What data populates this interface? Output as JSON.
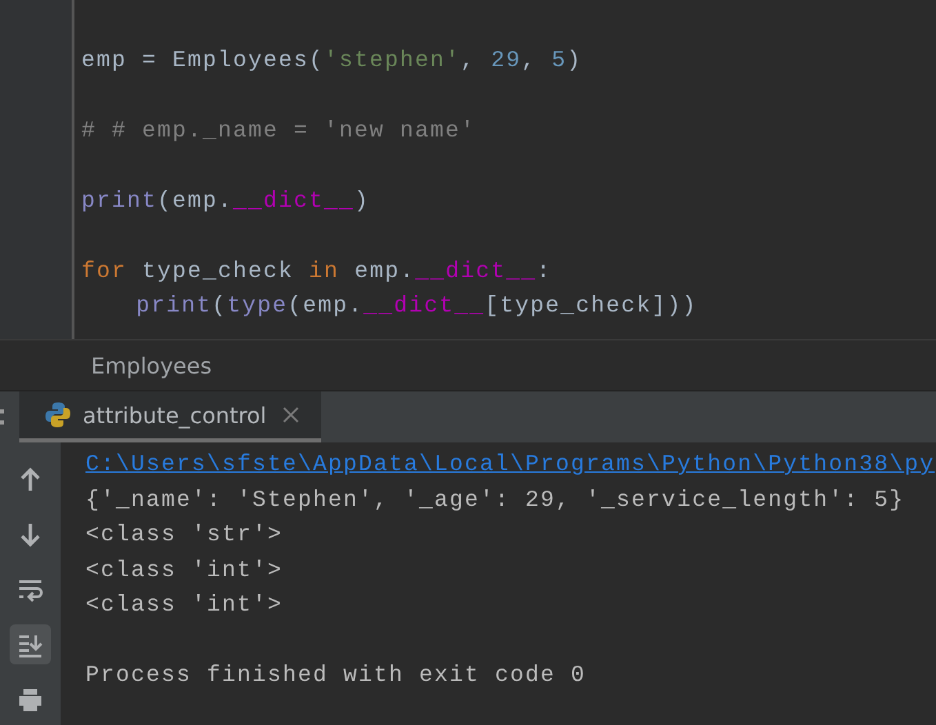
{
  "editor": {
    "lines": [
      {
        "kind": "blank"
      },
      {
        "kind": "code",
        "tokens": [
          {
            "kind": "plain",
            "text": "emp = Employees("
          },
          {
            "kind": "string",
            "text": "'stephen'"
          },
          {
            "kind": "plain",
            "text": ", "
          },
          {
            "kind": "number",
            "text": "29"
          },
          {
            "kind": "plain",
            "text": ", "
          },
          {
            "kind": "number",
            "text": "5"
          },
          {
            "kind": "plain",
            "text": ")"
          }
        ]
      },
      {
        "kind": "blank"
      },
      {
        "kind": "code",
        "tokens": [
          {
            "kind": "comment",
            "text": "# # emp._name = 'new name'"
          }
        ]
      },
      {
        "kind": "blank"
      },
      {
        "kind": "code",
        "tokens": [
          {
            "kind": "builtin",
            "text": "print"
          },
          {
            "kind": "plain",
            "text": "(emp."
          },
          {
            "kind": "dunder",
            "text": "__dict__"
          },
          {
            "kind": "plain",
            "text": ")"
          }
        ]
      },
      {
        "kind": "blank"
      },
      {
        "kind": "code",
        "tokens": [
          {
            "kind": "keyword",
            "text": "for"
          },
          {
            "kind": "plain",
            "text": " type_check "
          },
          {
            "kind": "keyword",
            "text": "in"
          },
          {
            "kind": "plain",
            "text": " emp."
          },
          {
            "kind": "dunder",
            "text": "__dict__"
          },
          {
            "kind": "plain",
            "text": ":"
          }
        ],
        "children": [
          {
            "kind": "code",
            "tokens": [
              {
                "kind": "builtin",
                "text": "print"
              },
              {
                "kind": "plain",
                "text": "("
              },
              {
                "kind": "builtin",
                "text": "type"
              },
              {
                "kind": "plain",
                "text": "(emp."
              },
              {
                "kind": "dunder",
                "text": "__dict__"
              },
              {
                "kind": "plain",
                "text": "[type_check]))"
              }
            ]
          }
        ]
      }
    ]
  },
  "breadcrumb": "Employees",
  "run_panel": {
    "tabs": [
      {
        "label": "attribute_control",
        "selected": true
      }
    ],
    "toolbar": [
      {
        "kind": "up",
        "selected": false
      },
      {
        "kind": "down",
        "selected": false
      },
      {
        "kind": "wrap",
        "selected": false
      },
      {
        "kind": "scroll_end",
        "selected": true
      },
      {
        "kind": "print",
        "selected": false
      }
    ],
    "console": [
      {
        "kind": "link",
        "text": "C:\\Users\\sfste\\AppData\\Local\\Programs\\Python\\Python38\\py"
      },
      {
        "kind": "output",
        "text": "{'_name': 'Stephen', '_age': 29, '_service_length': 5}"
      },
      {
        "kind": "output",
        "text": "<class 'str'>"
      },
      {
        "kind": "output",
        "text": "<class 'int'>"
      },
      {
        "kind": "output",
        "text": "<class 'int'>"
      },
      {
        "kind": "blank"
      },
      {
        "kind": "output",
        "text": "Process finished with exit code 0"
      }
    ]
  }
}
